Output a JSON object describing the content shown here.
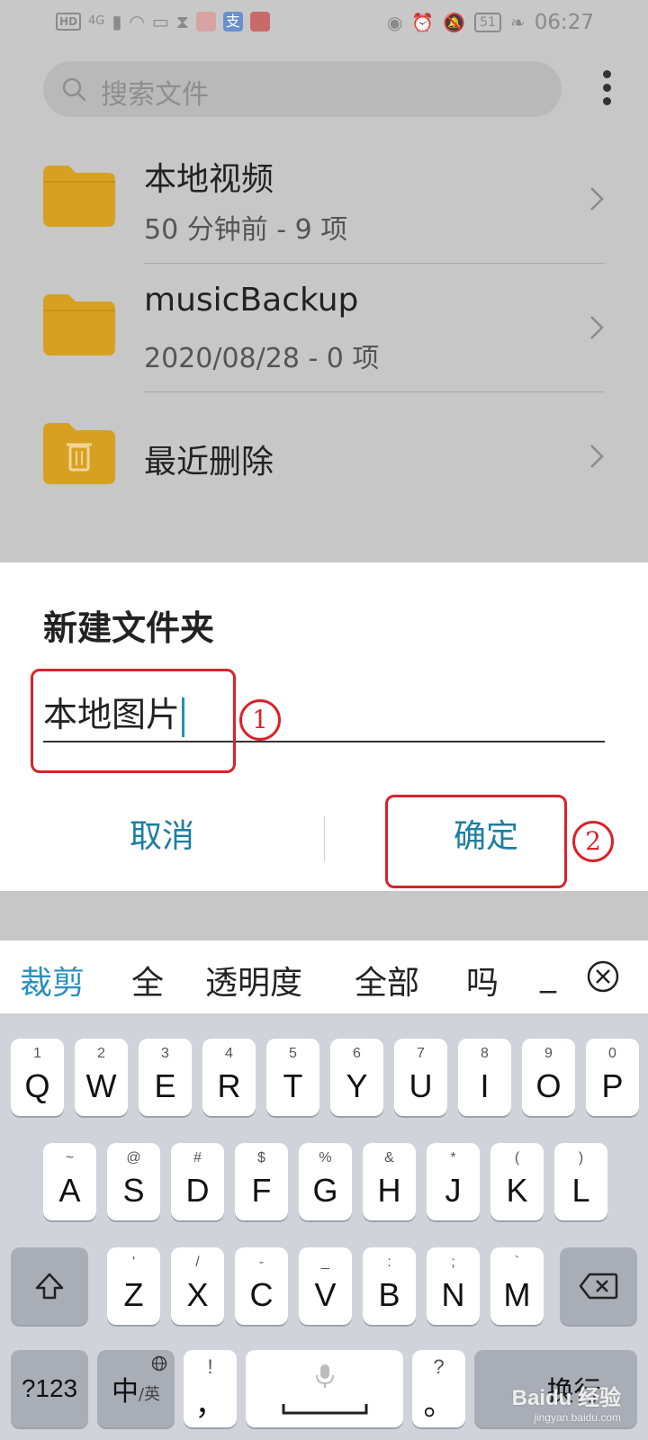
{
  "status_bar": {
    "left_icons": [
      "HD",
      "4G",
      "signal-icon",
      "wifi-icon",
      "message-icon",
      "hourglass-icon",
      "sina-app-icon",
      "alipay-app-icon",
      "huawei-app-icon"
    ],
    "hd": "HD",
    "net": "4G",
    "battery": "51",
    "time": "06:27"
  },
  "search": {
    "placeholder": "搜索文件"
  },
  "folders": [
    {
      "name": "本地视频",
      "meta": "50 分钟前 - 9 项",
      "icon": "folder-icon"
    },
    {
      "name": "musicBackup",
      "meta": "2020/08/28 - 0 项",
      "icon": "folder-icon"
    },
    {
      "name": "最近删除",
      "meta": "",
      "icon": "trash-folder-icon"
    }
  ],
  "dialog": {
    "title": "新建文件夹",
    "input_value": "本地图片",
    "cancel_label": "取消",
    "ok_label": "确定",
    "annotation_1": "1",
    "annotation_2": "2"
  },
  "candidates": {
    "items": [
      "裁剪",
      "全",
      "透明度",
      "全部",
      "吗",
      "_"
    ],
    "active_index": 0
  },
  "keyboard": {
    "row1": [
      {
        "main": "Q",
        "sub": "1"
      },
      {
        "main": "W",
        "sub": "2"
      },
      {
        "main": "E",
        "sub": "3"
      },
      {
        "main": "R",
        "sub": "4"
      },
      {
        "main": "T",
        "sub": "5"
      },
      {
        "main": "Y",
        "sub": "6"
      },
      {
        "main": "U",
        "sub": "7"
      },
      {
        "main": "I",
        "sub": "8"
      },
      {
        "main": "O",
        "sub": "9"
      },
      {
        "main": "P",
        "sub": "0"
      }
    ],
    "row2": [
      {
        "main": "A",
        "sub": "~"
      },
      {
        "main": "S",
        "sub": "@"
      },
      {
        "main": "D",
        "sub": "#"
      },
      {
        "main": "F",
        "sub": "$"
      },
      {
        "main": "G",
        "sub": "%"
      },
      {
        "main": "H",
        "sub": "&"
      },
      {
        "main": "J",
        "sub": "*"
      },
      {
        "main": "K",
        "sub": "("
      },
      {
        "main": "L",
        "sub": ")"
      }
    ],
    "row3": [
      {
        "main": "Z",
        "sub": "'"
      },
      {
        "main": "X",
        "sub": "/"
      },
      {
        "main": "C",
        "sub": "-"
      },
      {
        "main": "V",
        "sub": "_"
      },
      {
        "main": "B",
        "sub": ":"
      },
      {
        "main": "N",
        "sub": ";"
      },
      {
        "main": "M",
        "sub": "`"
      }
    ],
    "num_label": "?123",
    "lang_main": "中",
    "lang_sub": "/英",
    "comma_main": "，",
    "comma_sub": "!",
    "period_main": "。",
    "period_sub": "?",
    "enter_label": "换行"
  },
  "watermark": {
    "brand": "Baidu 经验",
    "url": "jingyan.baidu.com"
  },
  "colors": {
    "accent": "#1d7ea3",
    "annotation": "#d9232a",
    "folder": "#d6a020"
  }
}
